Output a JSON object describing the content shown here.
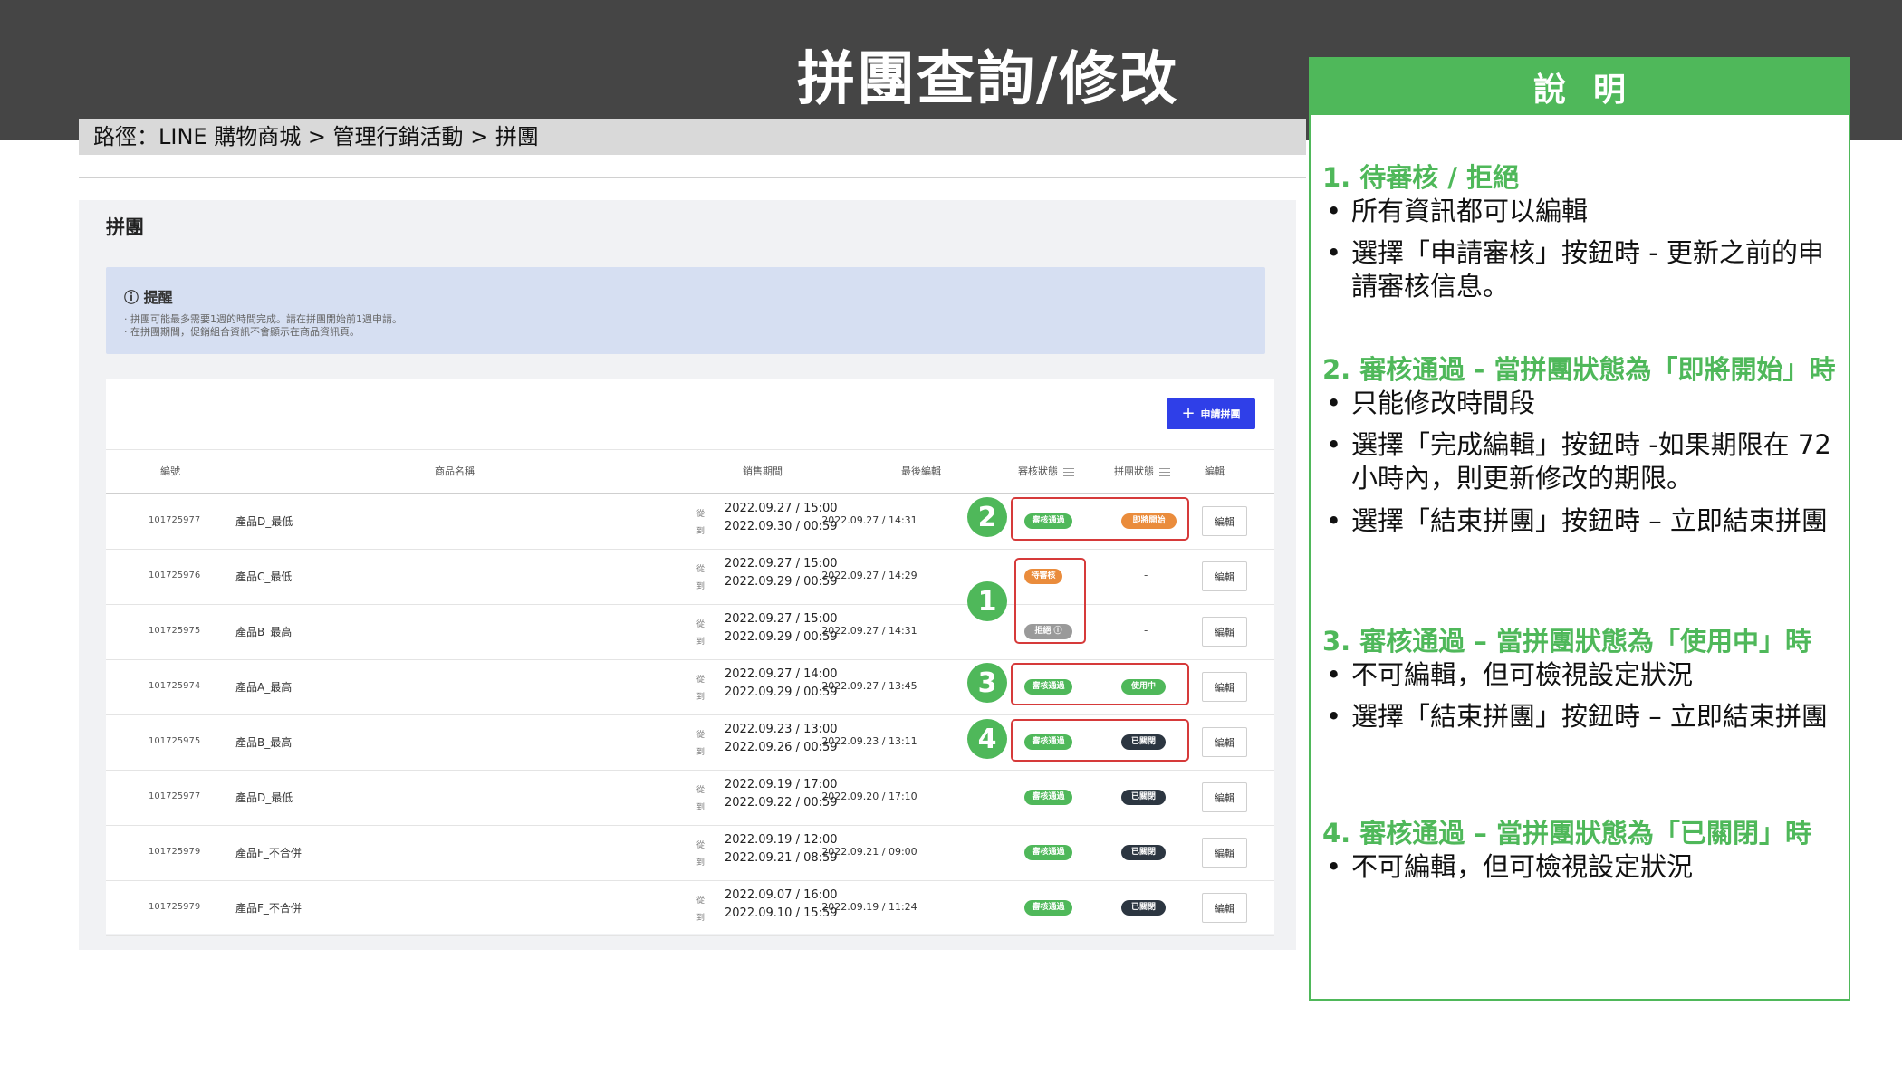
{
  "page_title": "拼團查詢/修改",
  "breadcrumb": "路徑：LINE 購物商城 > 管理行銷活動 > 拼團",
  "panel": {
    "title": "拼團",
    "notice": {
      "title": "提醒",
      "lines": [
        "· 拼團可能最多需要1週的時間完成。請在拼團開始前1週申請。",
        "· 在拼團期間，促銷組合資訊不會顯示在商品資訊頁。"
      ]
    },
    "apply_button": "申請拼團",
    "columns": [
      "編號",
      "商品名稱",
      "銷售期間",
      "最後編輯",
      "審核狀態",
      "拼團狀態",
      "編輯"
    ],
    "period_labels": {
      "from": "從",
      "to": "到"
    },
    "rows": [
      {
        "id": "101725977",
        "name": "產品D_最低",
        "from": "2022.09.27 / 15:00",
        "to": "2022.09.30 / 00:59",
        "last_edit": "2022.09.27 / 14:31",
        "review": "審核通過",
        "review_color": "green",
        "group": "即將開始",
        "group_color": "orange",
        "edit": "編輯"
      },
      {
        "id": "101725976",
        "name": "產品C_最低",
        "from": "2022.09.27 / 15:00",
        "to": "2022.09.29 / 00:59",
        "last_edit": "2022.09.27 / 14:29",
        "review": "待審核",
        "review_color": "orange",
        "group": "-",
        "group_color": "none",
        "edit": "編輯"
      },
      {
        "id": "101725975",
        "name": "產品B_最高",
        "from": "2022.09.27 / 15:00",
        "to": "2022.09.29 / 00:59",
        "last_edit": "2022.09.27 / 14:31",
        "review": "拒絕 ⓘ",
        "review_color": "gray",
        "group": "-",
        "group_color": "none",
        "edit": "編輯"
      },
      {
        "id": "101725974",
        "name": "產品A_最高",
        "from": "2022.09.27 / 14:00",
        "to": "2022.09.29 / 00:59",
        "last_edit": "2022.09.27 / 13:45",
        "review": "審核通過",
        "review_color": "green",
        "group": "使用中",
        "group_color": "green",
        "edit": "編輯"
      },
      {
        "id": "101725975",
        "name": "產品B_最高",
        "from": "2022.09.23 / 13:00",
        "to": "2022.09.26 / 00:59",
        "last_edit": "2022.09.23 / 13:11",
        "review": "審核通過",
        "review_color": "green",
        "group": "已關閉",
        "group_color": "dark",
        "edit": "編輯"
      },
      {
        "id": "101725977",
        "name": "產品D_最低",
        "from": "2022.09.19 / 17:00",
        "to": "2022.09.22 / 00:59",
        "last_edit": "2022.09.20 / 17:10",
        "review": "審核通過",
        "review_color": "green",
        "group": "已關閉",
        "group_color": "dark",
        "edit": "編輯"
      },
      {
        "id": "101725979",
        "name": "產品F_不合併",
        "from": "2022.09.19 / 12:00",
        "to": "2022.09.21 / 08:59",
        "last_edit": "2022.09.21 / 09:00",
        "review": "審核通過",
        "review_color": "green",
        "group": "已關閉",
        "group_color": "dark",
        "edit": "編輯"
      },
      {
        "id": "101725979",
        "name": "產品F_不合併",
        "from": "2022.09.07 / 16:00",
        "to": "2022.09.10 / 15:59",
        "last_edit": "2022.09.19 / 11:24",
        "review": "審核通過",
        "review_color": "green",
        "group": "已關閉",
        "group_color": "dark",
        "edit": "編輯"
      }
    ]
  },
  "callouts": [
    "1",
    "2",
    "3",
    "4"
  ],
  "side_panel": {
    "header": "說明",
    "sections": [
      {
        "title": "1. 待審核 / 拒絕",
        "bullets": [
          "所有資訊都可以編輯",
          "選擇「申請審核」按鈕時 - 更新之前的申請審核信息。"
        ]
      },
      {
        "title": "2. 審核通過 - 當拼團狀態為「即將開始」時",
        "bullets": [
          "只能修改時間段",
          "選擇「完成編輯」按鈕時 -如果期限在 72 小時內，則更新修改的期限。",
          "選擇「結束拼團」按鈕時 – 立即結束拼團"
        ]
      },
      {
        "title": "3. 審核通過 – 當拼團狀態為「使用中」時",
        "bullets": [
          "不可編輯，但可檢視設定狀況",
          "選擇「結束拼團」按鈕時 – 立即結束拼團"
        ]
      },
      {
        "title": "4. 審核通過 – 當拼團狀態為「已關閉」時",
        "bullets": [
          "不可編輯，但可檢視設定狀況"
        ]
      }
    ]
  },
  "colors": {
    "green": "#4fb85a",
    "orange": "#ea8c3c",
    "gray": "#9a9a9a",
    "dark": "#2c3641",
    "accent_blue": "#2f3fe8",
    "highlight_red": "#d63a3a",
    "header_bg": "#454545"
  }
}
